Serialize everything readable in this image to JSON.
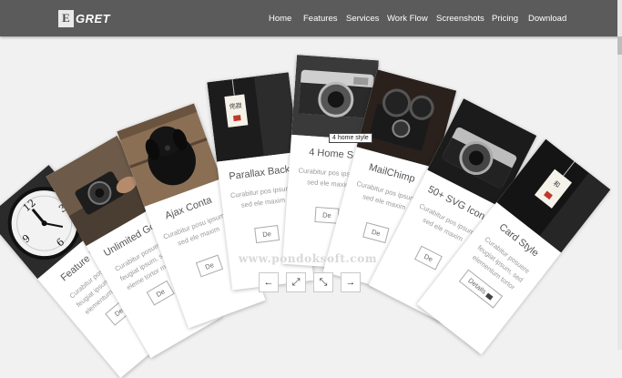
{
  "brand": {
    "mark": "E",
    "text": "GRET"
  },
  "nav": [
    {
      "label": "Home",
      "active": false
    },
    {
      "label": "Features",
      "active": true
    },
    {
      "label": "Services",
      "active": false
    },
    {
      "label": "Work Flow",
      "active": false
    },
    {
      "label": "Screenshots",
      "active": false
    },
    {
      "label": "Pricing",
      "active": false
    },
    {
      "label": "Download",
      "active": false
    }
  ],
  "cards": [
    {
      "title": "Feature H",
      "desc": "Curabitur posuere feugiat ipsum, sed elementum tortor maxim",
      "button": "De",
      "image": "clock"
    },
    {
      "title": "Unlimited Go",
      "desc": "Curabitur posuere feugiat ipsum, sed eleme tortor maxi",
      "button": "De",
      "image": "camera-hands"
    },
    {
      "title": "Ajax Conta",
      "desc": "Curabitur posu ipsum, sed ele maxim",
      "button": "De",
      "image": "dog"
    },
    {
      "title": "Parallax Back",
      "desc": "Curabitur pos ipsum, sed ele maxim",
      "button": "De",
      "image": "hanging-tag"
    },
    {
      "title": "4 Home S",
      "desc": "Curabitur pos ipsum, sed ele maxim",
      "button": "De",
      "image": "vintage-camera"
    },
    {
      "title": "MailChimp",
      "desc": "Curabitur pos ipsum, sed ele maxim",
      "button": "De",
      "image": "projector"
    },
    {
      "title": "50+ SVG Icon",
      "desc": "Curabitur pos ipsum, sed ele maxim",
      "button": "De",
      "image": "camera-lens"
    },
    {
      "title": "Card Style",
      "desc": "Curabitur posuere feugiat ipsum, sed elementum tortor maximus ut.",
      "button": "Details",
      "image": "tag-dark"
    }
  ],
  "tooltip": "4 home style",
  "watermark": "www.pondoksoft.com",
  "controls": [
    {
      "name": "prev-icon",
      "glyph": "←"
    },
    {
      "name": "expand-icon",
      "glyph": "⤢"
    },
    {
      "name": "collapse-icon",
      "glyph": "⤡"
    },
    {
      "name": "next-icon",
      "glyph": "→"
    }
  ]
}
